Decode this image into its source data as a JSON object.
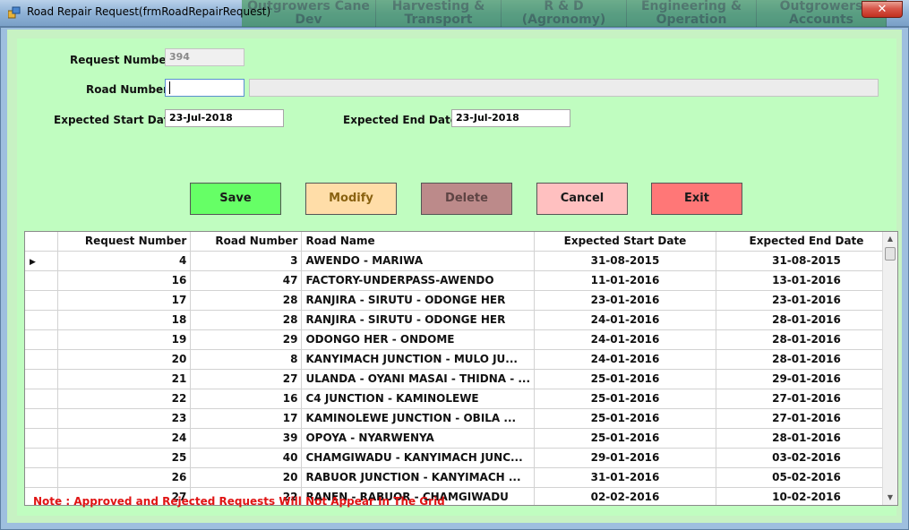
{
  "window": {
    "title": "Road Repair Request(frmRoadRepairRequest)",
    "close_label": "✕",
    "background_tabs": [
      "Outgrowers Cane Dev",
      "Harvesting & Transport",
      "R & D (Agronomy)",
      "Engineering & Operation",
      "Outgrowers Accounts"
    ]
  },
  "form": {
    "request_number_label": "Request Number",
    "request_number_value": "394",
    "road_number_label": "Road Number",
    "road_number_value": "",
    "road_name_value": "",
    "start_date_label": "Expected Start Date",
    "start_date_value": "23-Jul-2018",
    "end_date_label": "Expected End Date",
    "end_date_value": "23-Jul-2018"
  },
  "buttons": {
    "save": "Save",
    "modify": "Modify",
    "delete": "Delete",
    "cancel": "Cancel",
    "exit": "Exit"
  },
  "colors": {
    "save": "#66ff66",
    "modify": "#ffdda8",
    "delete": "#bc8a8a",
    "cancel": "#ffc0c0",
    "exit": "#ff7777",
    "note": "#e01414",
    "panel": "#c0fdc0"
  },
  "grid": {
    "columns": [
      "Request Number",
      "Road Number",
      "Road Name",
      "Expected Start Date",
      "Expected End Date"
    ],
    "rows": [
      [
        "4",
        "3",
        "AWENDO - MARIWA",
        "31-08-2015",
        "31-08-2015"
      ],
      [
        "16",
        "47",
        "FACTORY-UNDERPASS-AWENDO",
        "11-01-2016",
        "13-01-2016"
      ],
      [
        "17",
        "28",
        "RANJIRA - SIRUTU - ODONGE HER",
        "23-01-2016",
        "23-01-2016"
      ],
      [
        "18",
        "28",
        "RANJIRA - SIRUTU - ODONGE HER",
        "24-01-2016",
        "28-01-2016"
      ],
      [
        "19",
        "29",
        "ODONGO HER - ONDOME",
        "24-01-2016",
        "28-01-2016"
      ],
      [
        "20",
        "8",
        "KANYIMACH JUNCTION - MULO JU...",
        "24-01-2016",
        "28-01-2016"
      ],
      [
        "21",
        "27",
        "ULANDA - OYANI MASAI - THIDNA - ...",
        "25-01-2016",
        "29-01-2016"
      ],
      [
        "22",
        "16",
        "C4 JUNCTION - KAMINOLEWE",
        "25-01-2016",
        "27-01-2016"
      ],
      [
        "23",
        "17",
        "KAMINOLEWE JUNCTION - OBILA ...",
        "25-01-2016",
        "27-01-2016"
      ],
      [
        "24",
        "39",
        "OPOYA - NYARWENYA",
        "25-01-2016",
        "28-01-2016"
      ],
      [
        "25",
        "40",
        "CHAMGIWADU - KANYIMACH JUNC...",
        "29-01-2016",
        "03-02-2016"
      ],
      [
        "26",
        "20",
        "RABUOR JUNCTION - KANYIMACH ...",
        "31-01-2016",
        "05-02-2016"
      ],
      [
        "27",
        "22",
        "RANEN - RABUOR - CHAMGIWADU",
        "02-02-2016",
        "10-02-2016"
      ]
    ]
  },
  "note": "Note : Approved and Rejected Requests Will Not Appear In The Grid"
}
